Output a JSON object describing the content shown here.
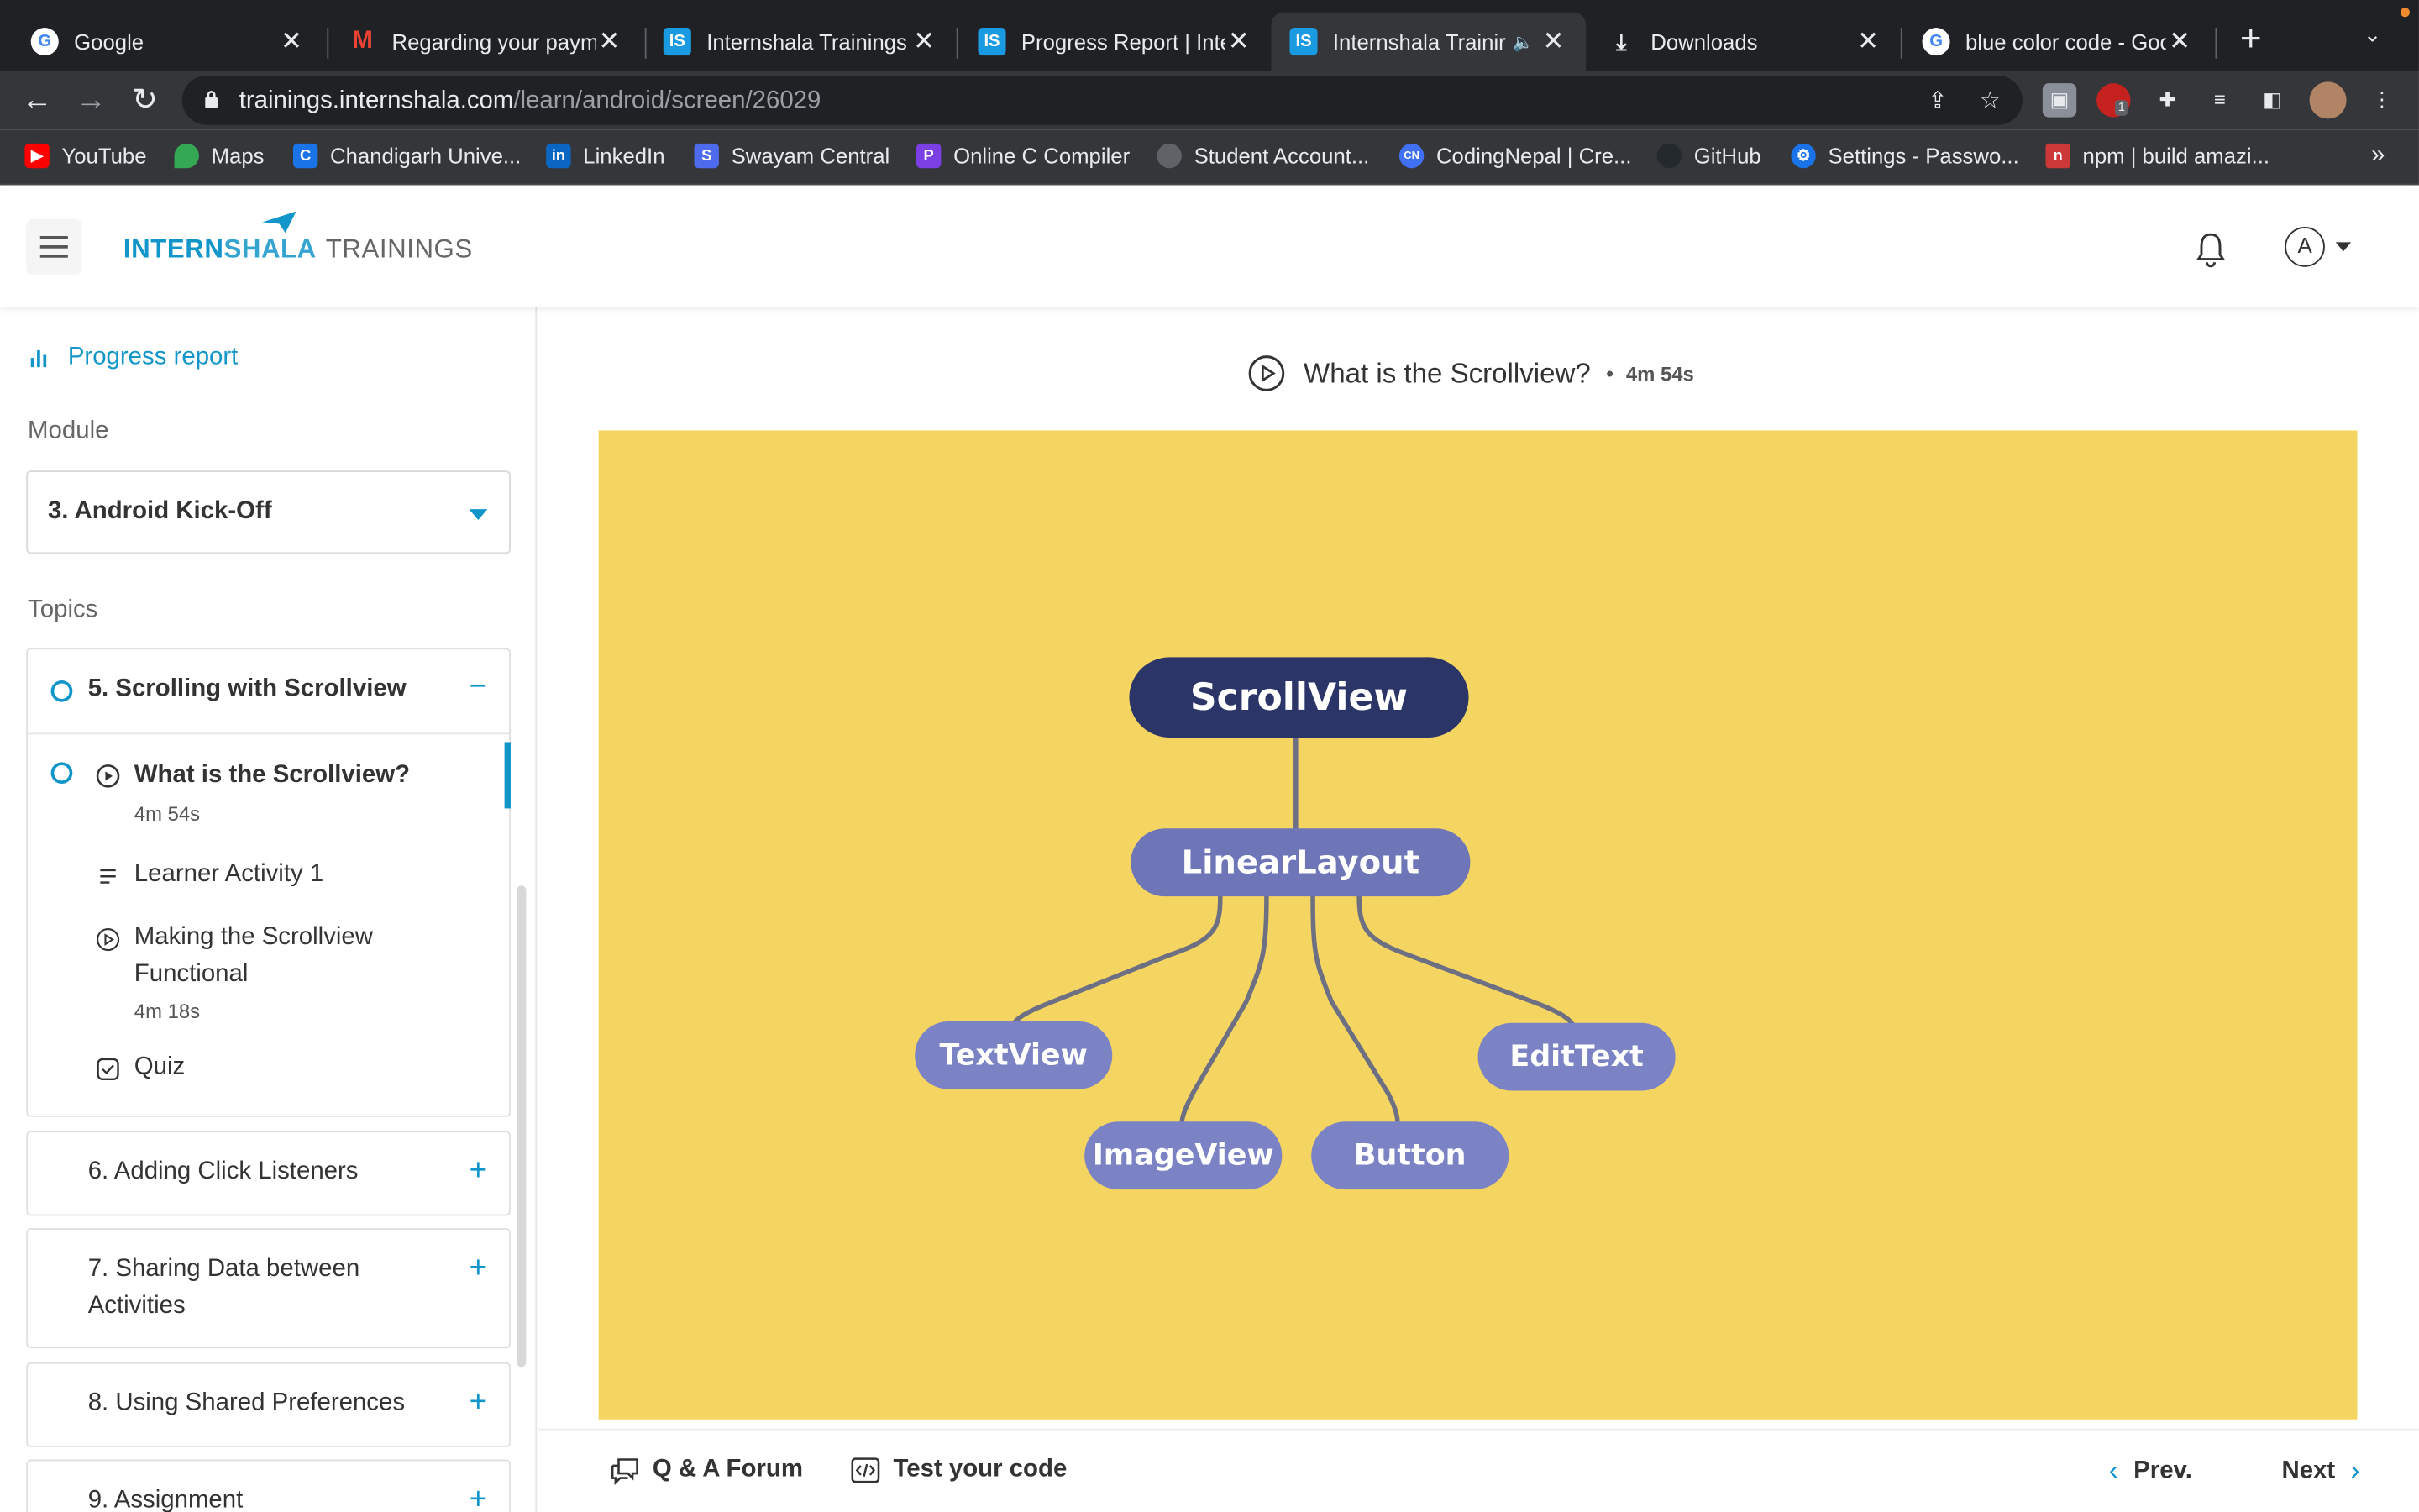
{
  "browser": {
    "tabs": [
      {
        "title": "Google",
        "icon": "google"
      },
      {
        "title": "Regarding your payme",
        "icon": "gmail"
      },
      {
        "title": "Internshala Trainings",
        "icon": "internshala"
      },
      {
        "title": "Progress Report | Inte",
        "icon": "internshala"
      },
      {
        "title": "Internshala Trainir",
        "icon": "internshala",
        "active": true,
        "audio": true
      },
      {
        "title": "Downloads",
        "icon": "download"
      },
      {
        "title": "blue color code - Goo",
        "icon": "google"
      }
    ],
    "url_host": "trainings.internshala.com",
    "url_path": "/learn/android/screen/26029",
    "extension_badge": "1",
    "bookmarks": [
      {
        "label": "YouTube",
        "color": "#ff0000"
      },
      {
        "label": "Maps",
        "color": "#34a853"
      },
      {
        "label": "Chandigarh Unive...",
        "color": "#1a73e8"
      },
      {
        "label": "LinkedIn",
        "color": "#0a66c2"
      },
      {
        "label": "Swayam Central",
        "color": "#4f6bed"
      },
      {
        "label": "Online C Compiler",
        "color": "#7b3fe4"
      },
      {
        "label": "Student Account...",
        "color": "#5f6368"
      },
      {
        "label": "CodingNepal | Cre...",
        "color": "#4070f4"
      },
      {
        "label": "GitHub",
        "color": "#24292e"
      },
      {
        "label": "Settings - Passwo...",
        "color": "#1a73e8"
      },
      {
        "label": "npm | build amazi...",
        "color": "#cb3837"
      }
    ],
    "bookmarks_more": "»"
  },
  "app": {
    "logo_part1": "INTERN",
    "logo_part2": "SHALA",
    "logo_part3": "TRAININGS",
    "profile_initial": "A",
    "accent": "#1295c9"
  },
  "sidebar": {
    "progress_link": "Progress report",
    "module_label": "Module",
    "module_selected": "3. Android Kick-Off",
    "topics_label": "Topics",
    "current_topic": {
      "title": "5. Scrolling with Scrollview",
      "toggle": "−",
      "items": [
        {
          "title": "What is the Scrollview?",
          "duration": "4m 54s",
          "type": "video",
          "active": true
        },
        {
          "title": "Learner Activity 1",
          "type": "text"
        },
        {
          "title": "Making the Scrollview",
          "title2": "Functional",
          "duration": "4m 18s",
          "type": "video"
        },
        {
          "title": "Quiz",
          "type": "quiz"
        }
      ]
    },
    "other_topics": [
      {
        "title": "6. Adding Click Listeners",
        "toggle": "+"
      },
      {
        "title": "7. Sharing Data between",
        "title2": "Activities",
        "toggle": "+"
      },
      {
        "title": "8. Using Shared Preferences",
        "toggle": "+"
      },
      {
        "title": "9. Assignment",
        "toggle": "+"
      }
    ]
  },
  "main": {
    "lesson_title": "What is the Scrollview?",
    "separator": "•",
    "lesson_duration": "4m 54s",
    "diagram": {
      "root": "ScrollView",
      "child": "LinearLayout",
      "leaves": [
        "TextView",
        "ImageView",
        "Button",
        "EditText"
      ],
      "background": "#f5d562"
    },
    "bottom": {
      "qa": "Q & A Forum",
      "test": "Test your code",
      "prev": "Prev.",
      "next": "Next"
    }
  }
}
